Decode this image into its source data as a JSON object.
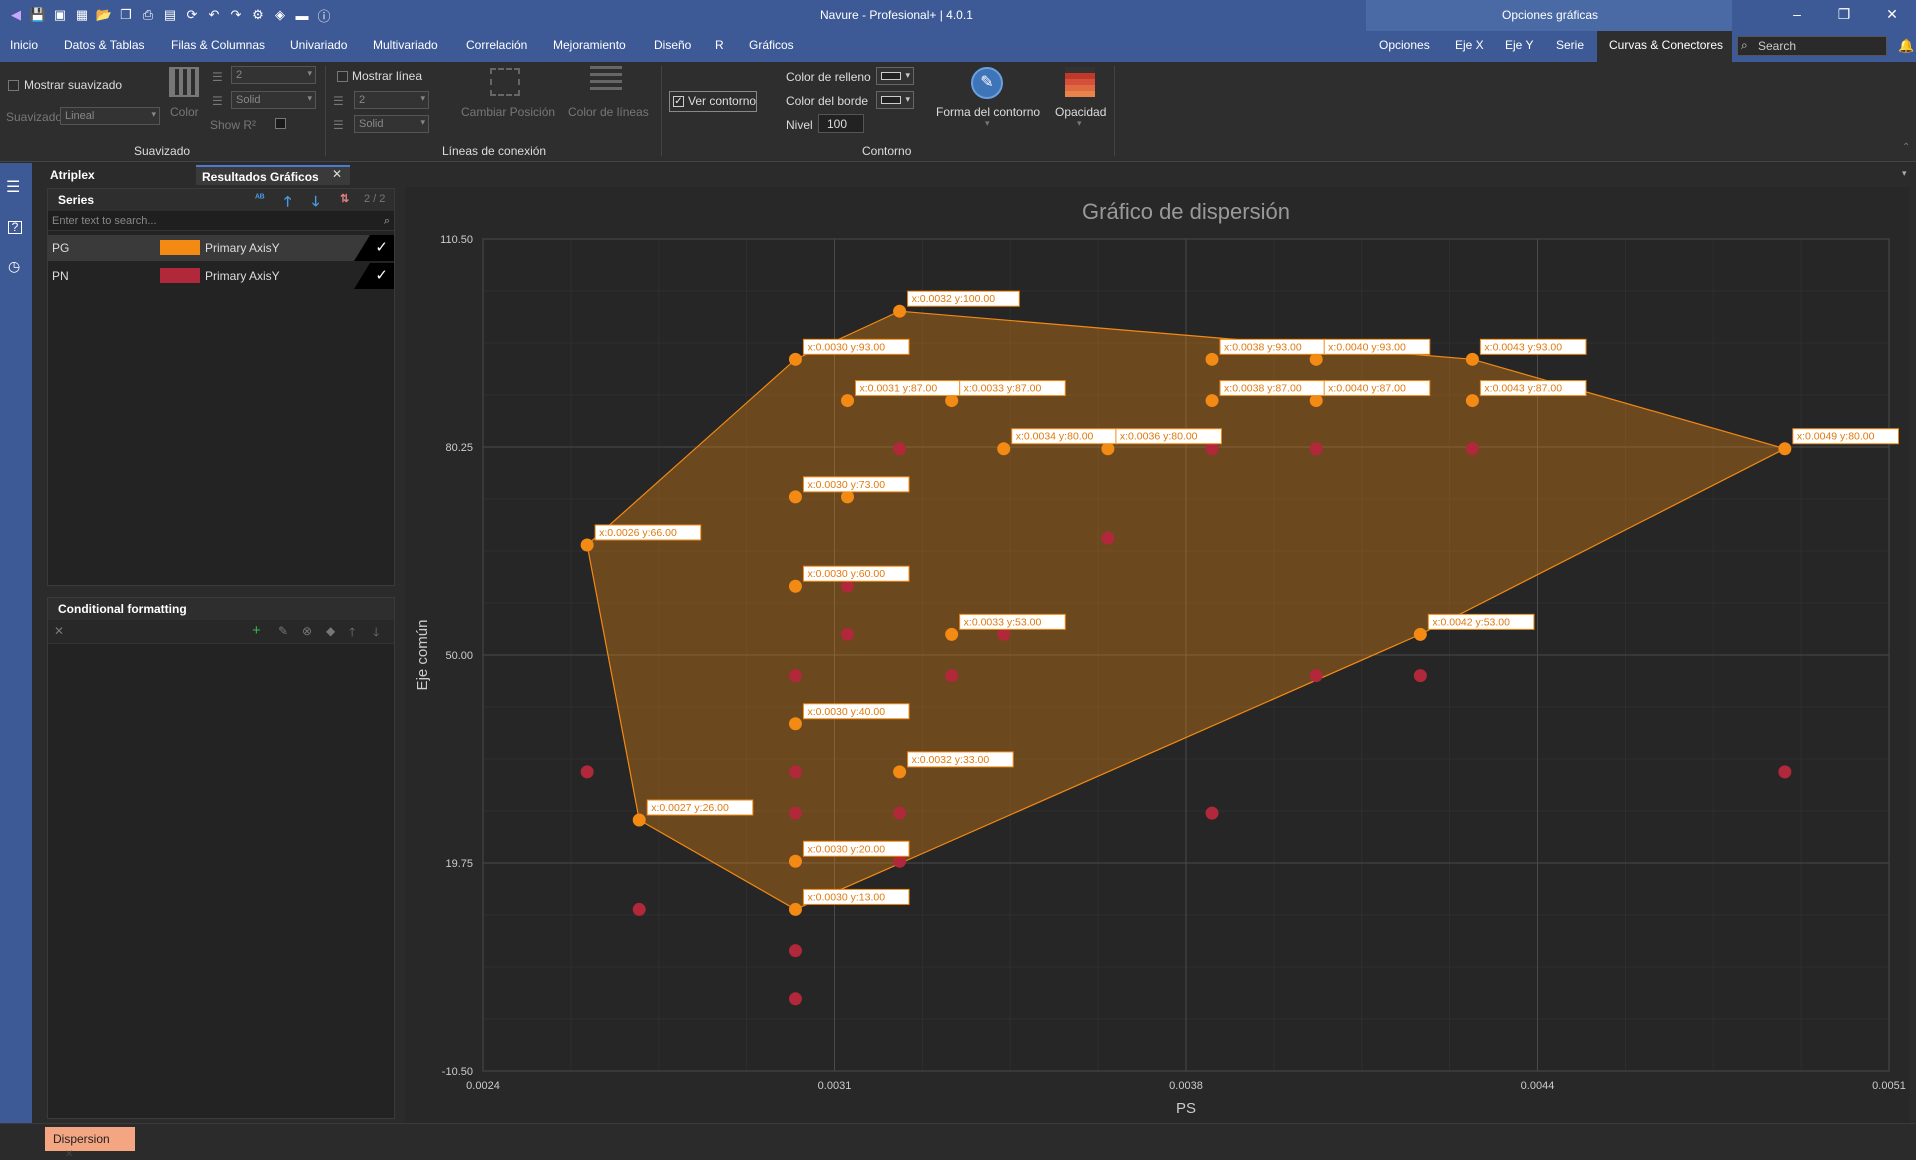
{
  "window": {
    "title": "Navure - Profesional+ | 4.0.1",
    "options_title": "Opciones gráficas"
  },
  "menu": [
    "Inicio",
    "Datos & Tablas",
    "Filas & Columnas",
    "Univariado",
    "Multivariado",
    "Correlación",
    "Mejoramiento",
    "Diseño",
    "R",
    "Gráficos"
  ],
  "option_tabs": [
    "Opciones",
    "Eje X",
    "Eje Y",
    "Serie",
    "Curvas & Conectores"
  ],
  "search": {
    "placeholder": "Search"
  },
  "ribbon": {
    "suavizado": {
      "show_label": "Mostrar suavizado",
      "type_label": "Suavizado",
      "type_value": "Lineal",
      "width_value": "2",
      "style_value": "Solid",
      "color_label": "Color",
      "show_r2": "Show R²",
      "group": "Suavizado"
    },
    "lineas": {
      "show_label": "Mostrar línea",
      "width_value": "2",
      "style_value": "Solid",
      "change_pos": "Cambiar Posición",
      "line_color": "Color de líneas",
      "group": "Líneas de conexión"
    },
    "contorno": {
      "show_label": "Ver contorno",
      "fill_label": "Color de relleno",
      "border_label": "Color del borde",
      "level_label": "Nivel",
      "level_value": "100",
      "shape_label": "Forma del contorno",
      "opacity_label": "Opacidad",
      "group": "Contorno"
    }
  },
  "panels": {
    "tabs": [
      "Atriplex",
      "Resultados Gráficos"
    ],
    "series": {
      "title": "Series",
      "count": "2 / 2",
      "search_placeholder": "Enter text to search...",
      "items": [
        {
          "name": "PG",
          "color": "#f28a14",
          "axis": "Primary AxisY"
        },
        {
          "name": "PN",
          "color": "#b0283a",
          "axis": "Primary AxisY"
        }
      ]
    },
    "cf": {
      "title": "Conditional formatting"
    }
  },
  "bottom_tab": "Dispersion",
  "chart_data": {
    "type": "scatter",
    "title": "Gráfico de dispersión",
    "xlabel": "PS",
    "ylabel": "Eje común",
    "xlim": [
      0.0024,
      0.0051
    ],
    "ylim": [
      -10.5,
      110.5
    ],
    "xticks": [
      "0.0024",
      "0.0031",
      "0.0038",
      "0.0044",
      "0.0051"
    ],
    "yticks": [
      "-10.50",
      "19.75",
      "50.00",
      "80.25",
      "110.50"
    ],
    "grid": true,
    "series": [
      {
        "name": "PG",
        "color": "#f28a14",
        "points": [
          [
            0.0032,
            100
          ],
          [
            0.003,
            93
          ],
          [
            0.0038,
            93
          ],
          [
            0.004,
            93
          ],
          [
            0.0043,
            93
          ],
          [
            0.0031,
            87
          ],
          [
            0.0033,
            87
          ],
          [
            0.0038,
            87
          ],
          [
            0.004,
            87
          ],
          [
            0.0043,
            87
          ],
          [
            0.0034,
            80
          ],
          [
            0.0036,
            80
          ],
          [
            0.0049,
            80
          ],
          [
            0.003,
            73
          ],
          [
            0.0031,
            73
          ],
          [
            0.0026,
            66
          ],
          [
            0.003,
            60
          ],
          [
            0.0033,
            53
          ],
          [
            0.0042,
            53
          ],
          [
            0.003,
            40
          ],
          [
            0.0032,
            33
          ],
          [
            0.0027,
            26
          ],
          [
            0.003,
            20
          ],
          [
            0.003,
            13
          ]
        ]
      },
      {
        "name": "PN",
        "color": "#b0283a",
        "points": [
          [
            0.0032,
            80
          ],
          [
            0.0038,
            80
          ],
          [
            0.004,
            80
          ],
          [
            0.0043,
            80
          ],
          [
            0.0043,
            87
          ],
          [
            0.0036,
            67
          ],
          [
            0.0031,
            60
          ],
          [
            0.0031,
            53
          ],
          [
            0.0033,
            53
          ],
          [
            0.0034,
            53
          ],
          [
            0.003,
            47
          ],
          [
            0.0033,
            47
          ],
          [
            0.004,
            47
          ],
          [
            0.0042,
            47
          ],
          [
            0.0026,
            33
          ],
          [
            0.003,
            33
          ],
          [
            0.0049,
            33
          ],
          [
            0.003,
            27
          ],
          [
            0.0032,
            27
          ],
          [
            0.0038,
            27
          ],
          [
            0.003,
            20
          ],
          [
            0.0032,
            20
          ],
          [
            0.0027,
            13
          ],
          [
            0.003,
            7
          ],
          [
            0.003,
            0
          ]
        ]
      }
    ],
    "labels": [
      {
        "x": 0.0032,
        "y": 100,
        "text": "x:0.0032 y:100.00"
      },
      {
        "x": 0.003,
        "y": 93,
        "text": "x:0.0030 y:93.00"
      },
      {
        "x": 0.0038,
        "y": 93,
        "text": "x:0.0038 y:93.00"
      },
      {
        "x": 0.004,
        "y": 93,
        "text": "x:0.0040 y:93.00"
      },
      {
        "x": 0.0043,
        "y": 93,
        "text": "x:0.0043 y:93.00"
      },
      {
        "x": 0.0031,
        "y": 87,
        "text": "x:0.0031 y:87.00"
      },
      {
        "x": 0.0033,
        "y": 87,
        "text": "x:0.0033 y:87.00"
      },
      {
        "x": 0.0038,
        "y": 87,
        "text": "x:0.0038 y:87.00"
      },
      {
        "x": 0.004,
        "y": 87,
        "text": "x:0.0040 y:87.00"
      },
      {
        "x": 0.0043,
        "y": 87,
        "text": "x:0.0043 y:87.00"
      },
      {
        "x": 0.0034,
        "y": 80,
        "text": "x:0.0034 y:80.00"
      },
      {
        "x": 0.0036,
        "y": 80,
        "text": "x:0.0036 y:80.00"
      },
      {
        "x": 0.0049,
        "y": 80,
        "text": "x:0.0049 y:80.00"
      },
      {
        "x": 0.003,
        "y": 73,
        "text": "x:0.0030 y:73.00"
      },
      {
        "x": 0.0026,
        "y": 66,
        "text": "x:0.0026 y:66.00"
      },
      {
        "x": 0.003,
        "y": 60,
        "text": "x:0.0030 y:60.00"
      },
      {
        "x": 0.0033,
        "y": 53,
        "text": "x:0.0033 y:53.00"
      },
      {
        "x": 0.0042,
        "y": 53,
        "text": "x:0.0042 y:53.00"
      },
      {
        "x": 0.003,
        "y": 40,
        "text": "x:0.0030 y:40.00"
      },
      {
        "x": 0.0032,
        "y": 33,
        "text": "x:0.0032 y:33.00"
      },
      {
        "x": 0.0027,
        "y": 26,
        "text": "x:0.0027 y:26.00"
      },
      {
        "x": 0.003,
        "y": 20,
        "text": "x:0.0030 y:20.00"
      },
      {
        "x": 0.003,
        "y": 13,
        "text": "x:0.0030 y:13.00"
      }
    ],
    "hull": [
      [
        0.0026,
        66
      ],
      [
        0.003,
        93
      ],
      [
        0.0032,
        100
      ],
      [
        0.0043,
        93
      ],
      [
        0.0049,
        80
      ],
      [
        0.0042,
        53
      ],
      [
        0.003,
        13
      ],
      [
        0.0027,
        26
      ]
    ]
  }
}
